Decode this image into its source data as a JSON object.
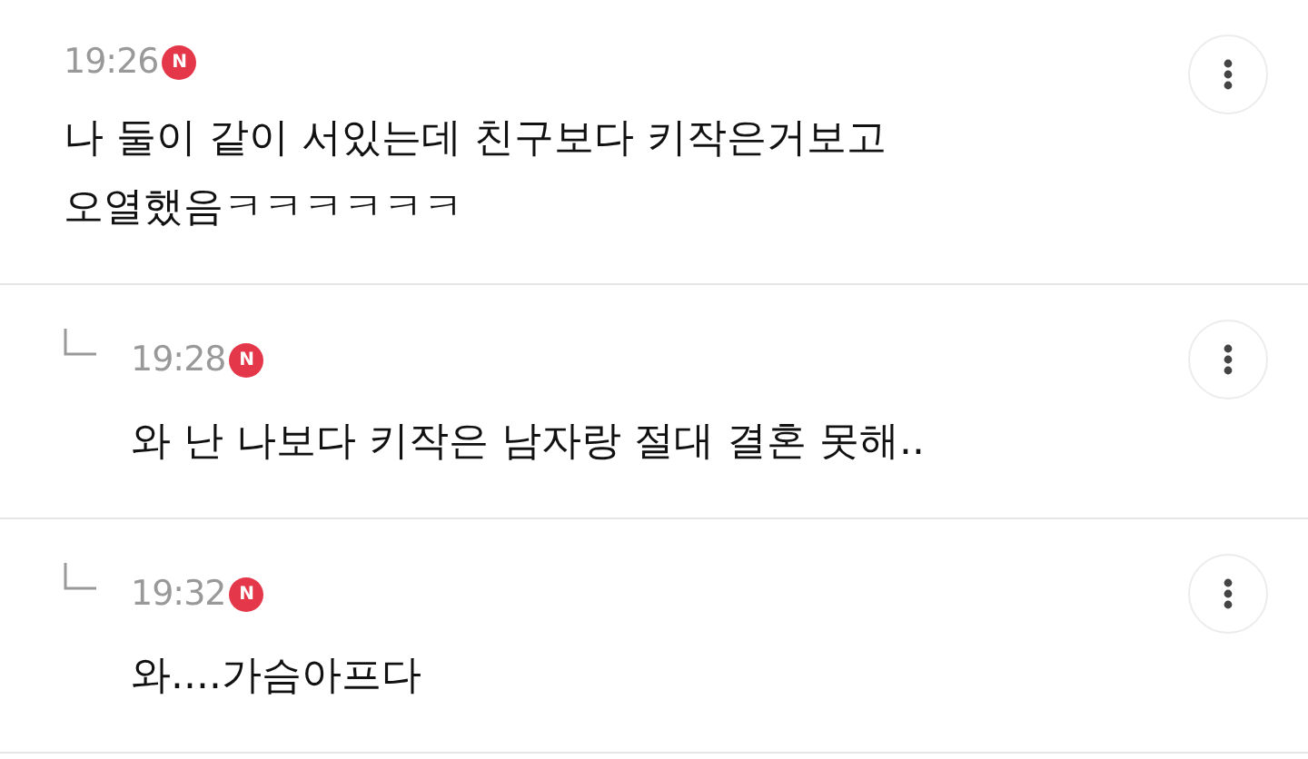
{
  "comments": [
    {
      "kind": "comment",
      "time": "19:26",
      "badge": "N",
      "lines": [
        "나 둘이 같이 서있는데 친구보다 키작은거보고",
        "오열했음ㅋㅋㅋㅋㅋㅋ"
      ]
    },
    {
      "kind": "reply",
      "time": "19:28",
      "badge": "N",
      "lines": [
        "와 난 나보다 키작은 남자랑 절대 결혼 못해.."
      ]
    },
    {
      "kind": "reply",
      "time": "19:32",
      "badge": "N",
      "lines": [
        "와....가슴아프다"
      ]
    }
  ]
}
